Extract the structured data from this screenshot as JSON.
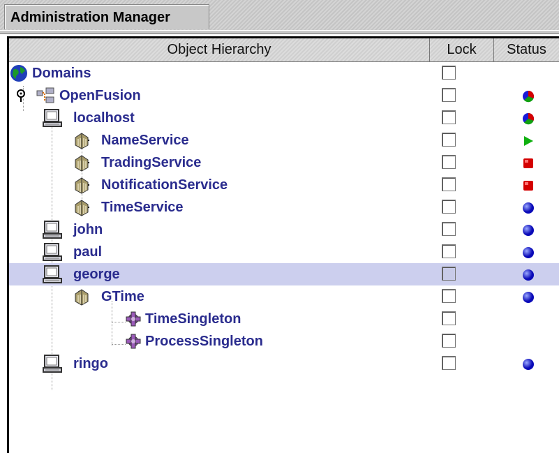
{
  "window": {
    "tab_title": "Administration Manager"
  },
  "table": {
    "columns": [
      "Object Hierarchy",
      "Lock",
      "Status"
    ]
  },
  "rows": [
    {
      "label": "Domains",
      "icon": "globe-icon",
      "status": null,
      "depth": 0
    },
    {
      "label": "OpenFusion",
      "icon": "network-icon",
      "status": "multicolor",
      "depth": 0
    },
    {
      "label": "localhost",
      "icon": "computer-icon",
      "status": "multicolor",
      "depth": 1
    },
    {
      "label": "NameService",
      "icon": "service-icon",
      "status": "running",
      "depth": 2
    },
    {
      "label": "TradingService",
      "icon": "service-icon",
      "status": "stopped",
      "depth": 2
    },
    {
      "label": "NotificationService",
      "icon": "service-icon",
      "status": "stopped",
      "depth": 2
    },
    {
      "label": "TimeService",
      "icon": "service-icon",
      "status": "idle",
      "depth": 2
    },
    {
      "label": "john",
      "icon": "computer-icon",
      "status": "idle",
      "depth": 1
    },
    {
      "label": "paul",
      "icon": "computer-icon",
      "status": "idle",
      "depth": 1
    },
    {
      "label": "george",
      "icon": "computer-icon",
      "status": "idle",
      "depth": 1,
      "selected": true
    },
    {
      "label": "GTime",
      "icon": "service-icon",
      "status": "idle",
      "depth": 2
    },
    {
      "label": "TimeSingleton",
      "icon": "component-icon",
      "status": null,
      "depth": 3
    },
    {
      "label": "ProcessSingleton",
      "icon": "component-icon",
      "status": null,
      "depth": 3
    },
    {
      "label": "ringo",
      "icon": "computer-icon",
      "status": "idle",
      "depth": 1
    }
  ],
  "colors": {
    "label": "#2a2c8e",
    "selected_row": "#cccfee",
    "status_idle": "#1a1ad8",
    "status_stopped": "#d40000",
    "status_running": "#10b010"
  }
}
